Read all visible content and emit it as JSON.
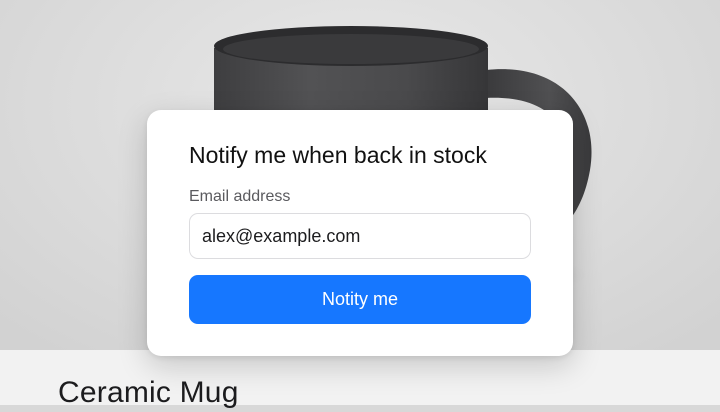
{
  "modal": {
    "title": "Notify me when back in stock",
    "email_label": "Email address",
    "email_value": "alex@example.com",
    "button_label": "Notity me"
  },
  "product": {
    "title": "Ceramic Mug"
  },
  "colors": {
    "accent": "#1677ff",
    "mug": "#4a4a4c",
    "background": "#dcdcdc"
  }
}
